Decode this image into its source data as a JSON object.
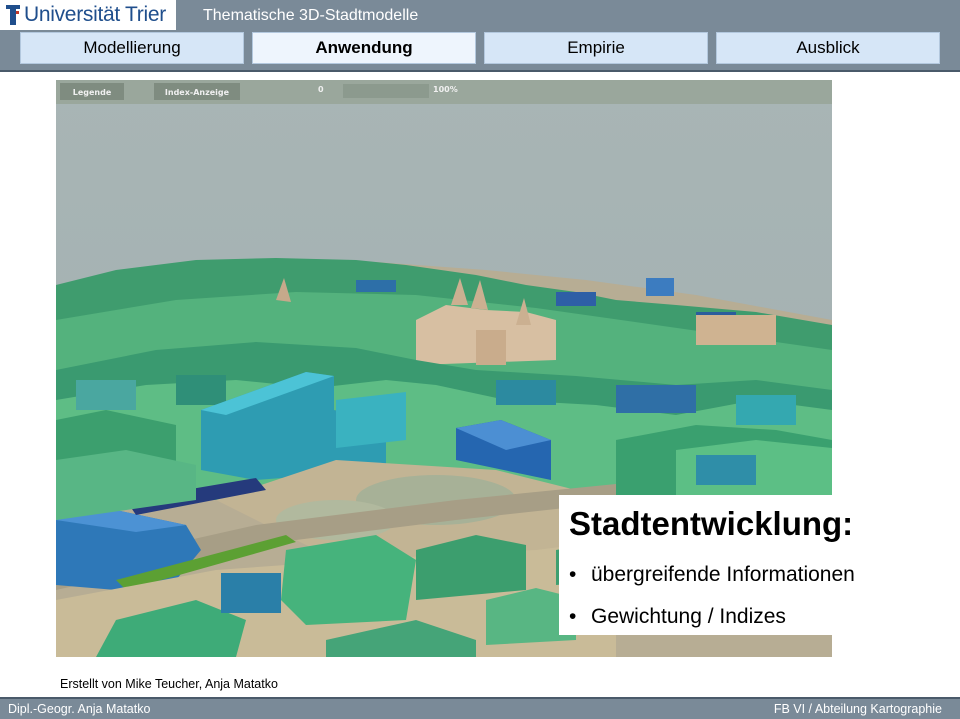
{
  "header": {
    "logo_text": "Universität Trier",
    "title": "Thematische 3D-Stadtmodelle"
  },
  "nav": {
    "tabs": [
      {
        "label": "Modellierung",
        "active": false
      },
      {
        "label": "Anwendung",
        "active": true
      },
      {
        "label": "Empirie",
        "active": false
      },
      {
        "label": "Ausblick",
        "active": false
      }
    ]
  },
  "scene": {
    "toolbar": {
      "legend_button": "Legende",
      "index_button": "Index-Anzeige",
      "scale_min": "0",
      "scale_max": "100%"
    }
  },
  "overlay": {
    "title": "Stadtentwicklung:",
    "bullets": [
      "übergreifende Informationen",
      "Gewichtung / Indizes"
    ]
  },
  "credit": "Erstellt von Mike Teucher, Anja Matatko",
  "footer": {
    "left": "Dipl.-Geogr. Anja Matatko",
    "right": "FB VI / Abteilung Kartographie"
  },
  "colors": {
    "header_bg": "#7a8a98",
    "tab_bg": "#d6e6f7",
    "logo_blue": "#1f4e8c"
  }
}
